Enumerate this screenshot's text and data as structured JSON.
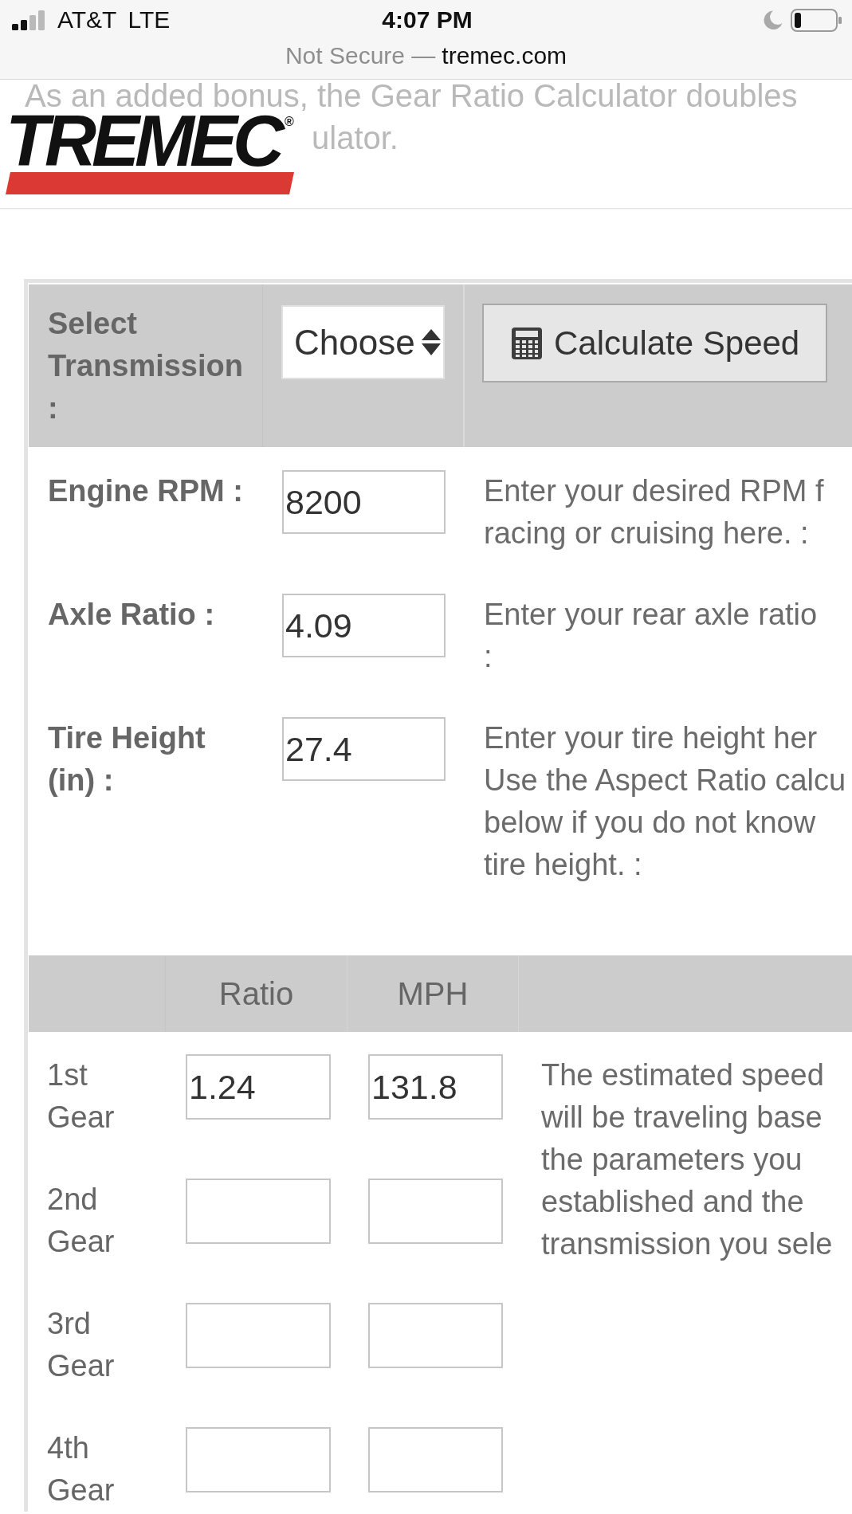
{
  "status_bar": {
    "carrier": "AT&T",
    "network": "LTE",
    "time": "4:07 PM"
  },
  "address_bar": {
    "security": "Not Secure —",
    "domain": "tremec.com"
  },
  "header": {
    "background_text": [
      "As an added bonus, the Gear Ratio Calculator doubles",
      "ulator."
    ],
    "logo": "TREMEC$^{®}$"
  },
  "transmission": {
    "label": "Select Transmission :",
    "select_value": "Choose",
    "button": "Calculate Speed"
  },
  "inputs": [
    {
      "label": "Engine RPM :",
      "value": "8200",
      "description": [
        "Enter your desired RPM f",
        "racing or cruising here. :"
      ]
    },
    {
      "label": "Axle Ratio :",
      "value": "4.09",
      "description": [
        "Enter your rear axle ratio",
        ":"
      ]
    },
    {
      "label": "Tire Height (in) :",
      "value": "27.4",
      "description": [
        "Enter your tire height her",
        "Use the Aspect Ratio calcu",
        "below if you do not know",
        "tire height. :"
      ]
    }
  ],
  "gear_table": {
    "columns": [
      "Ratio",
      "MPH"
    ],
    "rows": [
      {
        "label": "1st Gear",
        "ratio": "1.24",
        "mph": "131.8"
      },
      {
        "label": "2nd Gear"
      },
      {
        "label": "3rd Gear"
      },
      {
        "label": "4th Gear"
      }
    ],
    "description": [
      "The estimated speed",
      "will be traveling base",
      "the parameters you",
      "established and the",
      "transmission you sele"
    ]
  }
}
